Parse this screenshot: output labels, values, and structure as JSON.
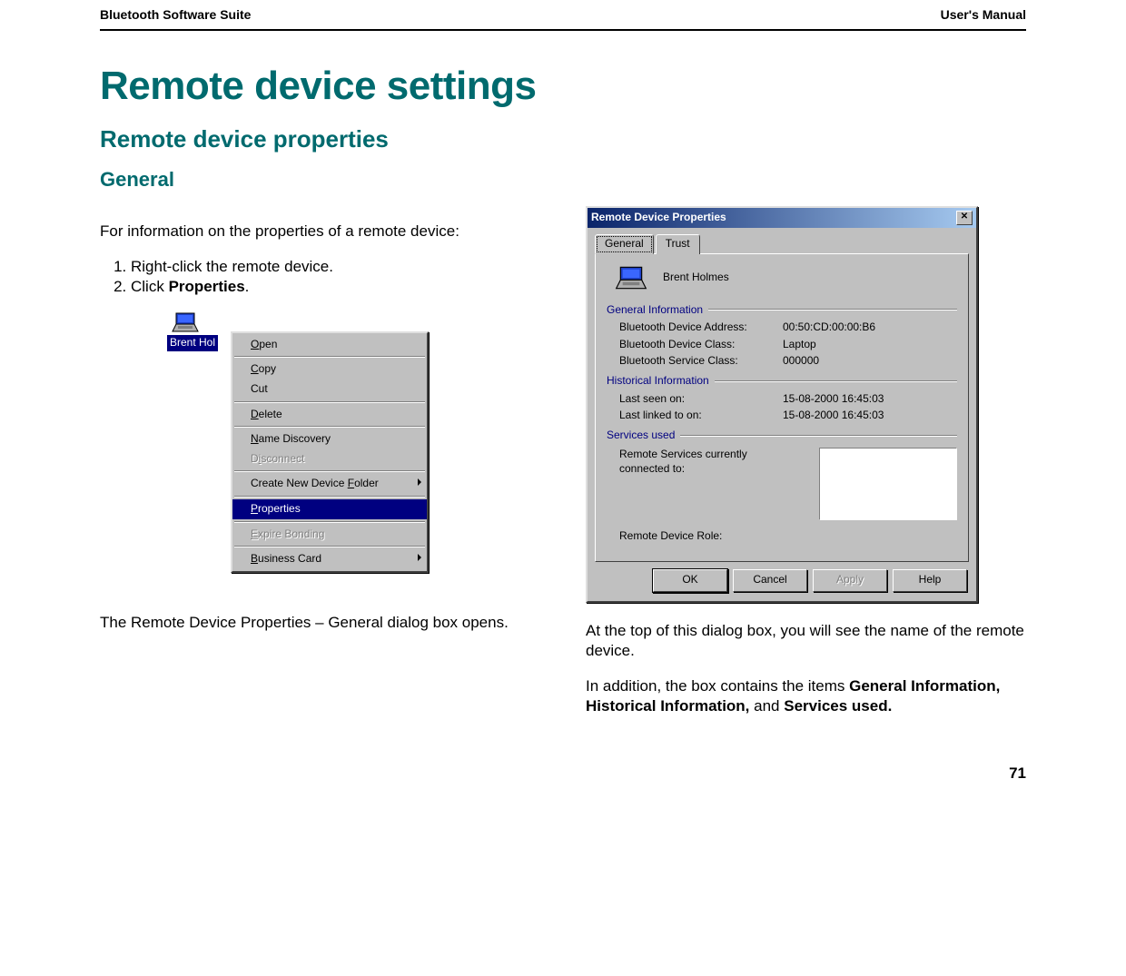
{
  "header": {
    "left": "Bluetooth Software Suite",
    "right": "User's Manual"
  },
  "title": "Remote device settings",
  "section": "Remote device properties",
  "subsection": "General",
  "intro": "For information on the properties of a remote device:",
  "steps": {
    "s1": "Right-click the remote device.",
    "s2_pre": "Click ",
    "s2_bold": "Properties",
    "s2_post": "."
  },
  "device_label": "Brent Hol",
  "context_menu": {
    "open": "Open",
    "copy": "Copy",
    "cut": "Cut",
    "delete": "Delete",
    "name_discovery": "Name Discovery",
    "disconnect": "Disconnect",
    "create_folder": "Create New Device Folder",
    "properties": "Properties",
    "expire_bonding": "Expire Bonding",
    "business_card": "Business Card"
  },
  "below_figure": "The Remote Device Properties – General dialog box opens.",
  "dialog": {
    "title": "Remote Device Properties",
    "tabs": {
      "general": "General",
      "trust": "Trust"
    },
    "device_name": "Brent Holmes",
    "groups": {
      "general_info": "General Information",
      "historical_info": "Historical Information",
      "services_used": "Services used"
    },
    "rows": {
      "address_label": "Bluetooth Device Address:",
      "address_value": "00:50:CD:00:00:B6",
      "class_label": "Bluetooth Device Class:",
      "class_value": "Laptop",
      "service_class_label": "Bluetooth Service Class:",
      "service_class_value": "000000",
      "last_seen_label": "Last seen on:",
      "last_seen_value": "15-08-2000 16:45:03",
      "last_linked_label": "Last linked to on:",
      "last_linked_value": "15-08-2000 16:45:03",
      "services_conn_label": "Remote Services currently connected to:",
      "remote_role_label": "Remote Device Role:"
    },
    "buttons": {
      "ok": "OK",
      "cancel": "Cancel",
      "apply": "Apply",
      "help": "Help"
    }
  },
  "right_text": {
    "p1": "At the top of this dialog box, you will see the name of the remote device.",
    "p2_pre": "In addition, the box contains the items ",
    "p2_b1": "General Information, Historical Information,",
    "p2_mid": " and ",
    "p2_b2": "Services used."
  },
  "page_number": "71"
}
